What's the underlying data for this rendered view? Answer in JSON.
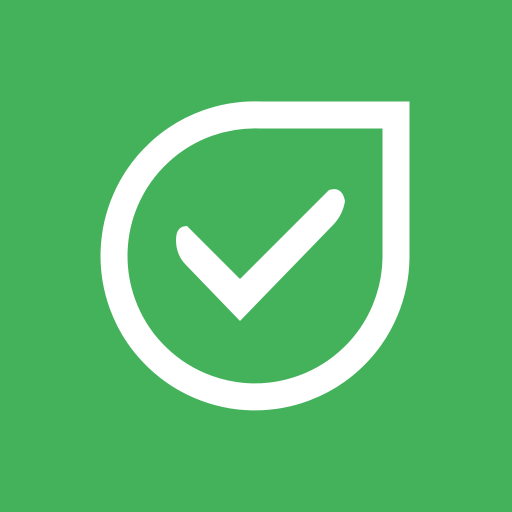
{
  "icon": {
    "name": "leaf-check-icon",
    "glyph": "checkmark",
    "background_color": "#43B25A",
    "foreground_color": "#FFFFFF"
  }
}
